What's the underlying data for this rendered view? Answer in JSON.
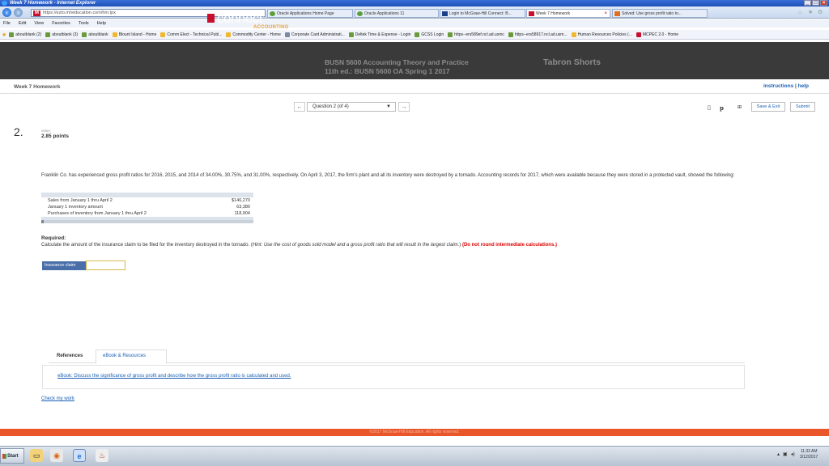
{
  "window": {
    "title": "Week 7 Homework - Internet Explorer",
    "controls": [
      "_",
      "□",
      "×"
    ]
  },
  "browser": {
    "address": "https://ezto.mheducation.com/hm.tpx",
    "tabs": [
      {
        "label": "Oracle Applications Home Page",
        "icon_color": "#5a9f3a"
      },
      {
        "label": "Oracle Applications 11",
        "icon_color": "#5a9f3a"
      },
      {
        "label": "Login to McGraw-Hill Connect: B...",
        "icon_color": "#1c3f8a"
      },
      {
        "label": "Week 7 Homework",
        "icon_color": "#c8102e",
        "active": true,
        "close": "×"
      },
      {
        "label": "Solved: Use gross profit ratio to...",
        "icon_color": "#e0701c"
      }
    ],
    "menu": [
      "File",
      "Edit",
      "View",
      "Favorites",
      "Tools",
      "Help"
    ],
    "favorites": [
      {
        "label": "aboutblank (2)",
        "icon_color": "#6a9a3a"
      },
      {
        "label": "aboutblank (3)",
        "icon_color": "#6a9a3a"
      },
      {
        "label": "aboutblank",
        "icon_color": "#6a9a3a"
      },
      {
        "label": "Blount Island - Home",
        "icon_color": "#f0b830"
      },
      {
        "label": "Comm Elect - Technical Publ...",
        "icon_color": "#f0b830"
      },
      {
        "label": "Commodity Center - Home",
        "icon_color": "#f0b830"
      },
      {
        "label": "Corporate Card Administrati...",
        "icon_color": "#7a8aa0"
      },
      {
        "label": "Deltek Time & Expense - Login",
        "icon_color": "#6a9a3a"
      },
      {
        "label": "GCSS Login",
        "icon_color": "#6a9a3a"
      },
      {
        "label": "https--ers589ef.ncl.ad.usmc",
        "icon_color": "#6a9a3a"
      },
      {
        "label": "https--ers58917.ncl.ad.usm...",
        "icon_color": "#6a9a3a"
      },
      {
        "label": "Human Resources Policies (...",
        "icon_color": "#f0b830"
      },
      {
        "label": "MCPEC 2.0 - Home",
        "icon_color": "#c8102e"
      }
    ]
  },
  "header": {
    "brand": "connect",
    "brand_sub": "ACCOUNTING",
    "course_line1": "BUSN 5600 Accounting Theory and Practice",
    "course_line2": "11th ed.: BUSN 5600 OA Spring 1 2017",
    "student": "Tabron Shorts"
  },
  "subheader": {
    "assignment": "Week 7 Homework",
    "instructions": "instructions",
    "sep": "|",
    "help": "help"
  },
  "nav": {
    "prev": "←",
    "question_select": "Question 2 (of 4)",
    "next": "→",
    "save_exit": "Save & Exit",
    "submit": "Submit"
  },
  "question": {
    "number": "2.",
    "value_label": "value:",
    "points": "2.85 points",
    "problem_text": "Franklin Co. has experienced gross profit ratios for 2016, 2015, and 2014 of 34.00%, 30.75%, and 31.00%, respectively. On April 3, 2017, the firm's plant and all its inventory were destroyed by a tornado. Accounting records for 2017, which were available because they were stored in a protected vault, showed the following:",
    "table": [
      {
        "label": "Sales from January 1 thru April 2",
        "value": "$146,270"
      },
      {
        "label": "January 1 inventory amount",
        "value": "63,380"
      },
      {
        "label": "Purchases of inventory from January 1 thru April 2",
        "value": "118,904"
      }
    ],
    "required_label": "Required:",
    "instruction_main": "Calculate the amount of the insurance claim to be filed for the inventory destroyed in the tornado. (",
    "instruction_hint": "Hint: Use the cost of goods sold model and a gross profit ratio that will result in the largest claim.",
    "instruction_close": ") ",
    "instruction_red": "(Do not round intermediate calculations.)",
    "answer_label": "Insurance claim",
    "answer_value": ""
  },
  "references": {
    "tab_refs": "References",
    "tab_ebook": "eBook & Resources",
    "ebook_link": "eBook: Discuss the significance of gross profit and describe how the gross profit ratio is calculated and used.",
    "check_work": "Check my work"
  },
  "footer": {
    "copyright": "©2017 McGraw-Hill Education. All rights reserved."
  },
  "taskbar": {
    "start": "Start",
    "time": "11:33 AM",
    "date": "3/12/2017"
  }
}
